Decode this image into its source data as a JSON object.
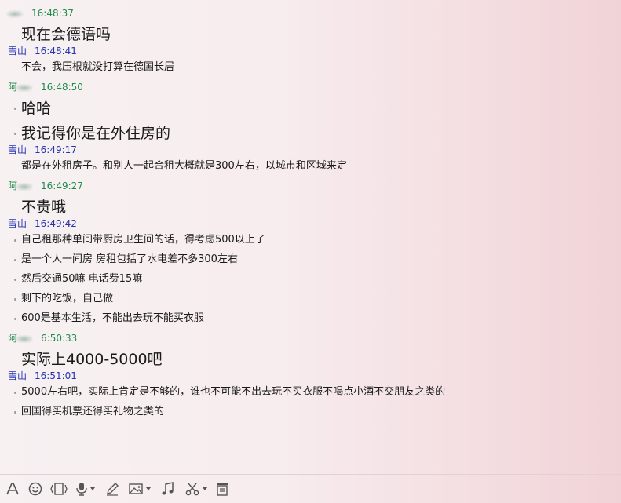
{
  "contacts": {
    "other_prefix": "阿",
    "me": "雪山"
  },
  "messages": [
    {
      "sender": "other",
      "time": "16:48:37",
      "lines": [
        "现在会德语吗"
      ],
      "size": "big"
    },
    {
      "sender": "me",
      "time": "16:48:41",
      "lines": [
        "不会，我压根就没打算在德国长居"
      ],
      "size": "small"
    },
    {
      "sender": "other",
      "time": "16:48:50",
      "lines": [
        "哈哈",
        "我记得你是在外住房的"
      ],
      "size": "big"
    },
    {
      "sender": "me",
      "time": "16:49:17",
      "lines": [
        "都是在外租房子。和别人一起合租大概就是300左右，以城市和区域来定"
      ],
      "size": "small"
    },
    {
      "sender": "other",
      "time": "16:49:27",
      "lines": [
        "不贵哦"
      ],
      "size": "big"
    },
    {
      "sender": "me",
      "time": "16:49:42",
      "lines": [
        "自己租那种单间带厨房卫生间的话，得考虑500以上了",
        "是一个人一间房 房租包括了水电差不多300左右",
        "然后交通50嘛 电话费15嘛",
        "剩下的吃饭，自己做",
        "600是基本生活，不能出去玩不能买衣服"
      ],
      "size": "small"
    },
    {
      "sender": "other",
      "time": "6:50:33",
      "lines": [
        "实际上4000-5000吧"
      ],
      "size": "big"
    },
    {
      "sender": "me",
      "time": "16:51:01",
      "lines": [
        "5000左右吧，实际上肯定是不够的，谁也不可能不出去玩不买衣服不喝点小酒不交朋友之类的",
        "回国得买机票还得买礼物之类的"
      ],
      "size": "small"
    }
  ],
  "toolbar": {
    "icons": [
      "font-icon",
      "emoji-icon",
      "screen-shake-icon",
      "voice-icon",
      "handwriting-icon",
      "image-icon",
      "music-icon",
      "screenshot-icon",
      "history-icon"
    ]
  }
}
